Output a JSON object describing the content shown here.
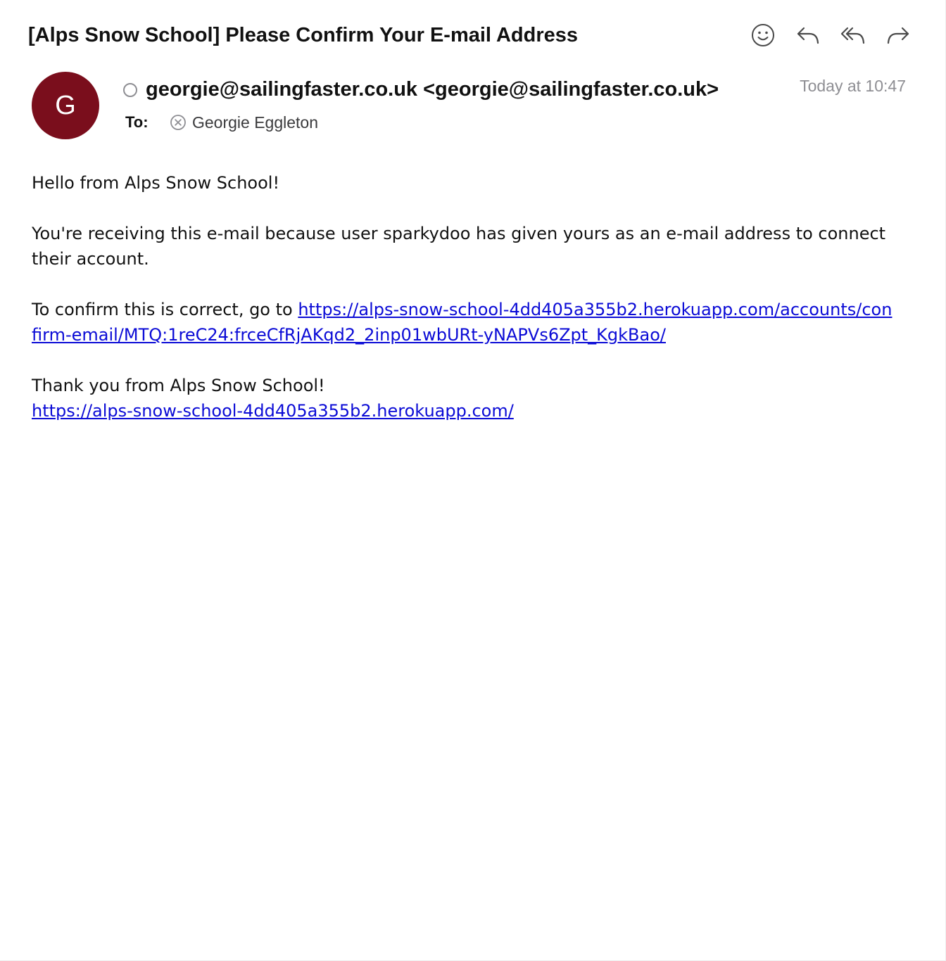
{
  "email": {
    "subject": "[Alps Snow School] Please Confirm Your E-mail Address",
    "avatar_initial": "G",
    "from": "georgie@sailingfaster.co.uk <georgie@sailingfaster.co.uk>",
    "timestamp": "Today at 10:47",
    "to_label": "To:",
    "recipient": "Georgie Eggleton"
  },
  "toolbar": {
    "icons": [
      "smiley-face-icon",
      "reply-icon",
      "reply-all-icon",
      "forward-icon"
    ]
  },
  "body": {
    "greeting": "Hello from Alps Snow School!",
    "notice": "You're receiving this e-mail because user sparkydoo has given yours as an e-mail address to connect their account.",
    "confirm_prefix": "To confirm this is correct, go to ",
    "confirm_link": "https://alps-snow-school-4dd405a355b2.herokuapp.com/accounts/confirm-email/MTQ:1reC24:frceCfRjAKqd2_2inp01wbURt-yNAPVs6Zpt_KgkBao/",
    "thanks": "Thank you from Alps Snow School!",
    "site_link": "https://alps-snow-school-4dd405a355b2.herokuapp.com/"
  },
  "colors": {
    "avatar_bg": "#7a0e1c",
    "link": "#0b0bd6",
    "muted": "#8e8e93"
  }
}
